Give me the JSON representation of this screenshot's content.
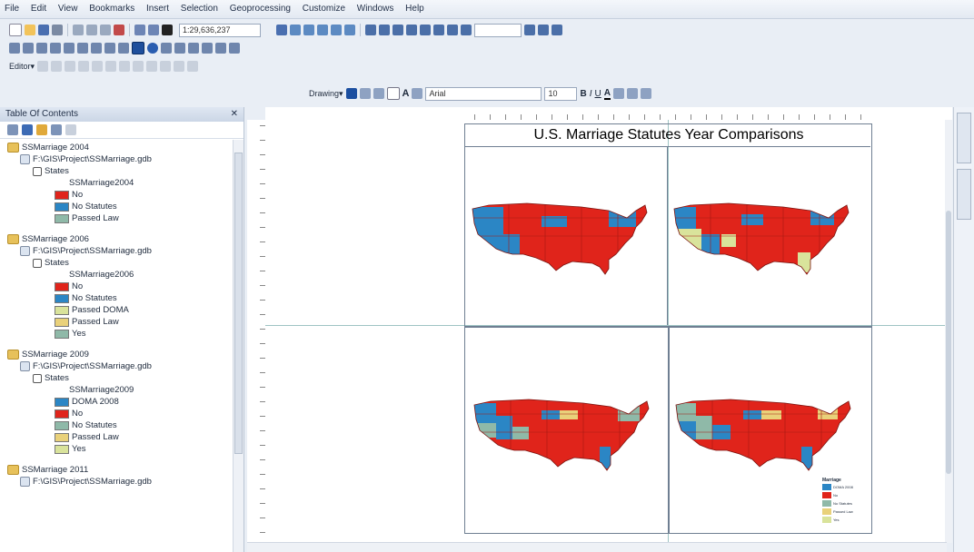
{
  "menu": [
    "File",
    "Edit",
    "View",
    "Bookmarks",
    "Insert",
    "Selection",
    "Geoprocessing",
    "Customize",
    "Windows",
    "Help"
  ],
  "toolbar": {
    "scale": "1:29,636,237",
    "editor": "Editor▾",
    "drawing": "Drawing▾",
    "font": "Arial",
    "font_size": "10"
  },
  "toc": {
    "title": "Table Of Contents",
    "groups": [
      {
        "name": "SSMarriage 2004",
        "path": "F:\\GIS\\Project\\SSMarriage.gdb",
        "layer": "States",
        "field": "SSMarriage2004",
        "classes": [
          {
            "label": "No",
            "color": "#e0241b"
          },
          {
            "label": "No Statutes",
            "color": "#2b86c5"
          },
          {
            "label": "Passed Law",
            "color": "#8fb9a8"
          }
        ]
      },
      {
        "name": "SSMarriage 2006",
        "path": "F:\\GIS\\Project\\SSMarriage.gdb",
        "layer": "States",
        "field": "SSMarriage2006",
        "classes": [
          {
            "label": "No",
            "color": "#e0241b"
          },
          {
            "label": "No Statutes",
            "color": "#2b86c5"
          },
          {
            "label": "Passed DOMA",
            "color": "#d9e39b"
          },
          {
            "label": "Passed Law",
            "color": "#e9d17a"
          },
          {
            "label": "Yes",
            "color": "#8fb9a8"
          }
        ]
      },
      {
        "name": "SSMarriage 2009",
        "path": "F:\\GIS\\Project\\SSMarriage.gdb",
        "layer": "States",
        "field": "SSMarriage2009",
        "classes": [
          {
            "label": "DOMA 2008",
            "color": "#2b86c5"
          },
          {
            "label": "No",
            "color": "#e0241b"
          },
          {
            "label": "No Statutes",
            "color": "#8fb9a8"
          },
          {
            "label": "Passed Law",
            "color": "#e9d17a"
          },
          {
            "label": "Yes",
            "color": "#d9e39b"
          }
        ]
      },
      {
        "name": "SSMarriage 2011",
        "path": "F:\\GIS\\Project\\SSMarriage.gdb",
        "layer": "",
        "field": "",
        "classes": []
      }
    ]
  },
  "layout": {
    "title": "U.S. Marriage Statutes Year Comparisons",
    "legend_title": "Marriage",
    "legend_items": [
      {
        "label": "DOMA 2008",
        "color": "#2b86c5"
      },
      {
        "label": "No",
        "color": "#e0241b"
      },
      {
        "label": "No Statutes",
        "color": "#8fb9a8"
      },
      {
        "label": "Passed Law",
        "color": "#e9d17a"
      },
      {
        "label": "Yes",
        "color": "#d9e39b"
      }
    ]
  },
  "colors": {
    "red": "#e0241b",
    "blue": "#2b86c5",
    "teal": "#8fb9a8",
    "yellow": "#e9d17a",
    "pale": "#d9e39b"
  }
}
